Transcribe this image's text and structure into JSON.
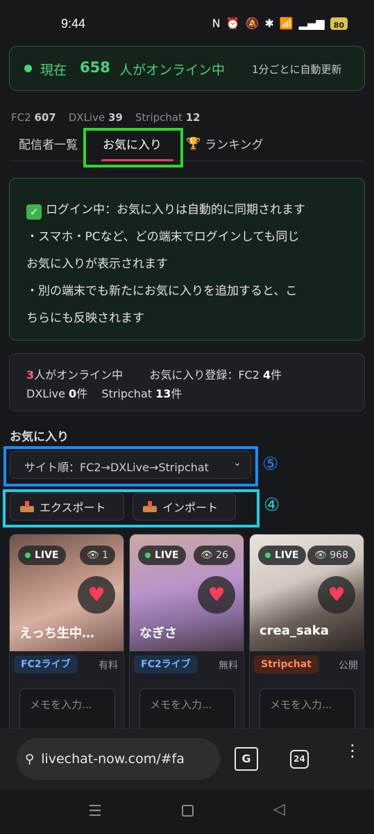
{
  "status_bar": {
    "time": "9:44",
    "battery": "80"
  },
  "online_banner": {
    "prefix": "現在",
    "count": "658",
    "suffix": "人がオンライン中",
    "update_note": "1分ごとに自動更新"
  },
  "site_counts": [
    {
      "name": "FC2",
      "count": "607"
    },
    {
      "name": "DXLive",
      "count": "39"
    },
    {
      "name": "Stripchat",
      "count": "12"
    }
  ],
  "tabs": {
    "list": "配信者一覧",
    "favorites": "お気に入り",
    "ranking": "ランキング",
    "ranking_icon": "🏆"
  },
  "info_panel": {
    "line1": "ログイン中：お気に入りは自動的に同期されます",
    "line2": "・スマホ・PCなど、どの端末でログインしても同じ",
    "line3": "お気に入りが表示されます",
    "line4": "・別の端末でも新たにお気に入りを追加すると、こ",
    "line5": "ちらにも反映されます"
  },
  "stats": {
    "online_count": "3",
    "online_suffix": "人がオンライン中",
    "registered_label": "お気に入り登録：FC2",
    "fc2_count": "4",
    "fc2_unit": "件",
    "dxlive_label": "DXLive",
    "dxlive_count": "0",
    "dxlive_unit": "件",
    "stripchat_label": "Stripchat",
    "stripchat_count": "13",
    "stripchat_unit": "件"
  },
  "favorites": {
    "heading": "お気に入り",
    "sort_selected": "サイト順：FC2→DXLive→Stripchat",
    "export_label": "エクスポート",
    "import_label": "インポート"
  },
  "annotations": {
    "marker_5": "⑤",
    "marker_4": "④"
  },
  "cards": [
    {
      "live": "LIVE",
      "viewers": "1",
      "name": "えっち生中…",
      "site": "FC2ライブ",
      "price": "有料",
      "memo_placeholder": "メモを入力..."
    },
    {
      "live": "LIVE",
      "viewers": "26",
      "name": "なぎさ",
      "site": "FC2ライブ",
      "price": "無料",
      "memo_placeholder": "メモを入力..."
    },
    {
      "live": "LIVE",
      "viewers": "968",
      "name": "crea_saka",
      "site": "Stripchat",
      "price": "公開",
      "memo_placeholder": "メモを入力..."
    }
  ],
  "browser": {
    "url": "livechat-now.com/#fa",
    "tab_count": "24"
  },
  "colors": {
    "accent_green": "#4cd17b",
    "tab_underline": "#e0465c",
    "highlight_green": "#2bd82b",
    "highlight_blue": "#1a8cff",
    "highlight_cyan": "#1ecfe6"
  }
}
